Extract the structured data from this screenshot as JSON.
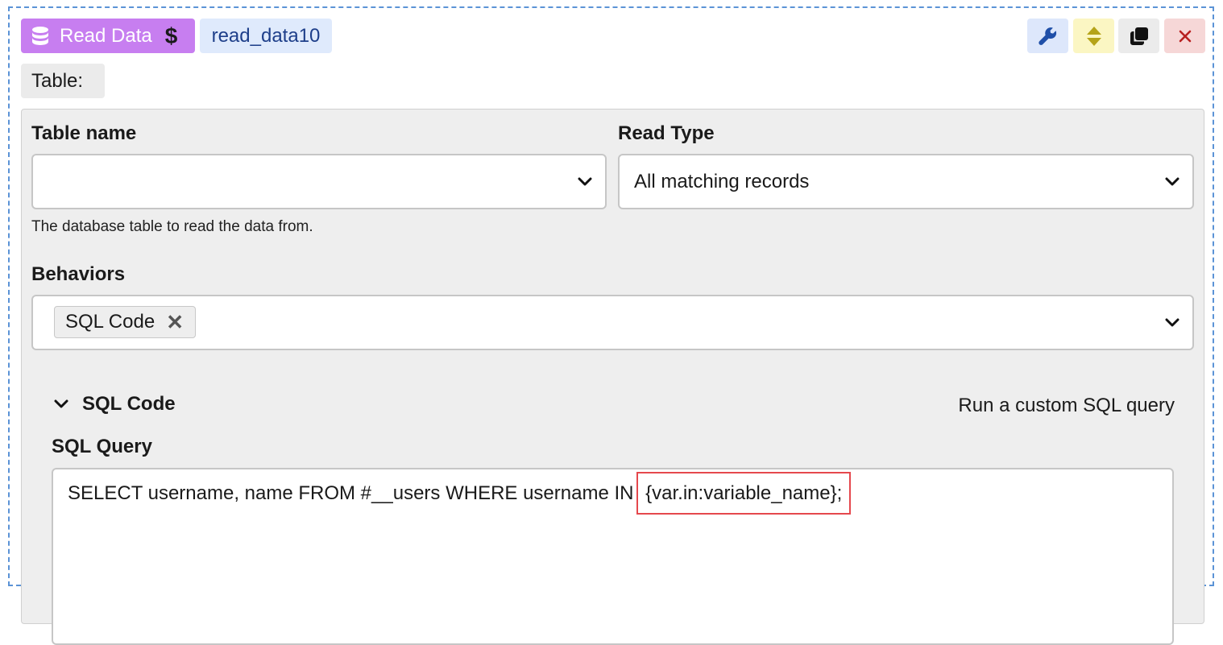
{
  "header": {
    "action_label": "Read Data",
    "action_symbol": "$",
    "block_name": "read_data10",
    "colors": {
      "action_bg": "#c77ef0",
      "name_bg": "#dfeafc",
      "settings_bg": "#dde7fb",
      "move_bg": "#fbf6c3",
      "copy_bg": "#ebebeb",
      "remove_bg": "#f6d7d7"
    },
    "icons": [
      "database-icon",
      "wrench-icon",
      "reorder-icon",
      "copy-icon",
      "close-icon"
    ]
  },
  "table_section_label": "Table:",
  "table_name": {
    "label": "Table name",
    "value": "",
    "help": "The database table to read the data from."
  },
  "read_type": {
    "label": "Read Type",
    "value": "All matching records"
  },
  "behaviors": {
    "label": "Behaviors",
    "chips": [
      {
        "label": "SQL Code",
        "remove_symbol": "✕"
      }
    ]
  },
  "sql_code": {
    "title": "SQL Code",
    "description": "Run a custom SQL query",
    "query_label": "SQL Query",
    "query_text": "SELECT username, name FROM #__users WHERE username IN ",
    "query_highlight": "{var.in:variable_name};",
    "highlight_color": "#e5484d"
  }
}
